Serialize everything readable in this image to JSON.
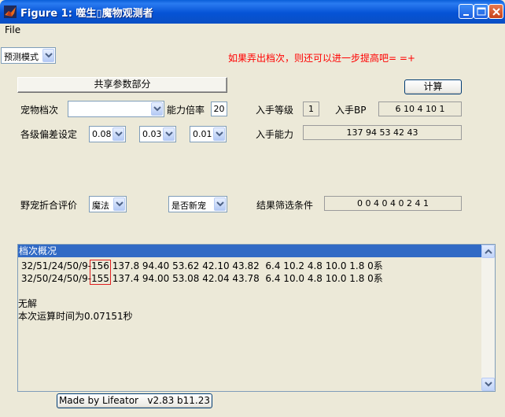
{
  "window": {
    "title": "Figure 1: 噬生▯魔物观测者",
    "controls": [
      "minimize",
      "maximize",
      "close"
    ]
  },
  "menu": {
    "file": "File"
  },
  "mode_select": {
    "value": "预测模式"
  },
  "hint": "如果弄出档次，则还可以进一步提高吧= =+",
  "buttons": {
    "shared_params": "共享参数部分",
    "calculate": "计算",
    "credit": "Made by Lifeator   v2.83 b11.23"
  },
  "form": {
    "pet_grade_label": "宠物档次",
    "pet_grade_value": "",
    "ability_mult_label": "能力倍率",
    "ability_mult_value": "20",
    "deviation_label": "各级偏差设定",
    "deviation_values": [
      "0.08",
      "0.03",
      "0.01"
    ],
    "obtain_level_label": "入手等级",
    "obtain_level_value": "1",
    "obtain_bp_label": "入手BP",
    "obtain_bp_value": "6 10 4 10 1",
    "obtain_ability_label": "入手能力",
    "obtain_ability_value": "137 94 53 42 43",
    "wild_eval_label": "野宠折合评价",
    "wild_eval_value": "魔法",
    "new_pet_value": "是否新宠",
    "filter_label": "结果筛选条件",
    "filter_value": "0 0 4 0 4 0 2 4 1"
  },
  "results": {
    "header": "档次概况",
    "rows": [
      {
        "prefix": " 32/51/24/50/9-",
        "grade": "156",
        "values": " 137.8 94.40 53.62 42.10 43.82  6.4 10.2 4.8 10.0 1.8 0系"
      },
      {
        "prefix": " 32/50/24/50/9-",
        "grade": "155",
        "values": " 137.4 94.00 53.08 42.04 43.78  6.4 10.0 4.8 10.0 1.8 0系"
      }
    ],
    "no_solution": "无解",
    "elapsed": "本次运算时间为0.07151秒"
  },
  "colors": {
    "titlebar": "#0A5FD8",
    "hint": "#FF0000",
    "list_header": "#316AC5",
    "highlight_box": "#E02020"
  }
}
